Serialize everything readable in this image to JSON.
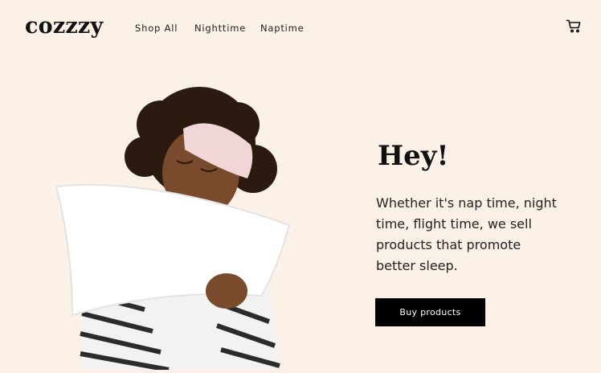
{
  "brand": {
    "logo": "cozzzy"
  },
  "nav": {
    "items": [
      {
        "label": "Shop All"
      },
      {
        "label": "Nighttime"
      },
      {
        "label": "Naptime"
      }
    ]
  },
  "hero": {
    "title": "Hey!",
    "text": "Whether it's nap time, night time, flight time, we sell products that promote better sleep.",
    "button_label": "Buy products"
  },
  "colors": {
    "background": "#fbf1e6",
    "button": "#000000",
    "text": "#111111"
  },
  "icons": {
    "cart": "shopping-cart-icon"
  }
}
